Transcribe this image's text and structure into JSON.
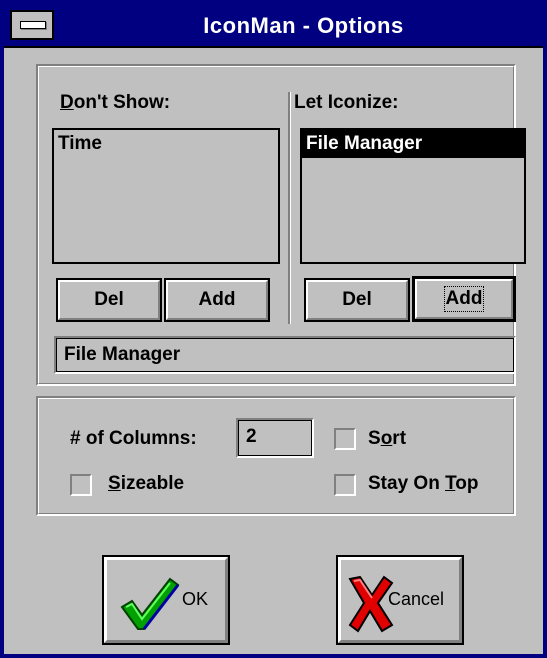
{
  "window": {
    "title": "IconMan - Options",
    "colors": {
      "titlebar": "#000080",
      "face": "#c0c0c0",
      "border": "#000080"
    }
  },
  "dont_show": {
    "label_underlined": "D",
    "label_rest": "on't Show:",
    "items": [
      "Time"
    ],
    "del_label": "Del",
    "add_label": "Add"
  },
  "let_iconize": {
    "label": "Let Iconize:",
    "items": [
      "File Manager"
    ],
    "selected_index": 0,
    "del_label": "Del",
    "add_label": "Add"
  },
  "entry_field": {
    "value": "File Manager"
  },
  "options": {
    "columns_label": "# of Columns:",
    "columns_value": "2",
    "sort_pre": "S",
    "sort_under": "o",
    "sort_post": "rt",
    "sort_checked": false,
    "sizeable_under": "S",
    "sizeable_post": "izeable",
    "sizeable_checked": false,
    "stay_pre": "Stay On ",
    "stay_under": "T",
    "stay_post": "op",
    "stay_checked": false
  },
  "buttons": {
    "ok_label": "OK",
    "ok_icon": "green-checkmark-icon",
    "cancel_label": "Cancel",
    "cancel_icon": "red-x-icon"
  }
}
